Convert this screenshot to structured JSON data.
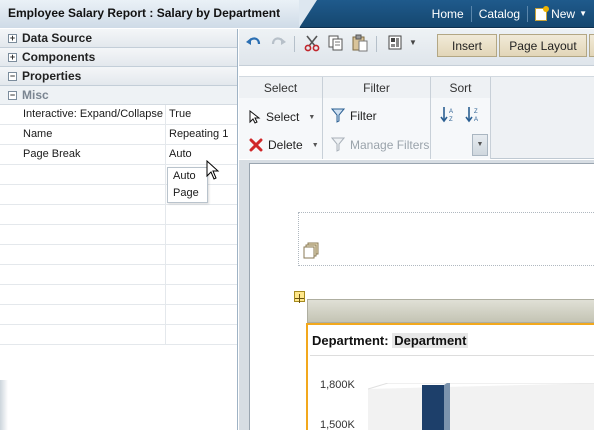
{
  "header": {
    "title": "Employee Salary Report : Salary by Department",
    "nav": {
      "home": "Home",
      "catalog": "Catalog",
      "new": "New"
    }
  },
  "left_panel": {
    "sections": [
      {
        "label": "Data Source",
        "state": "collapsed"
      },
      {
        "label": "Components",
        "state": "collapsed"
      },
      {
        "label": "Properties",
        "state": "expanded"
      }
    ],
    "group": "Misc",
    "properties": [
      {
        "name": "Interactive: Expand/Collapse",
        "value": "True"
      },
      {
        "name": "Name",
        "value": "Repeating 1"
      },
      {
        "name": "Page Break",
        "value": "Auto"
      }
    ],
    "dropdown_options": [
      "Auto",
      "Page"
    ]
  },
  "toolbar": {
    "tabs": [
      "Insert",
      "Page Layout"
    ]
  },
  "ribbon": {
    "select": {
      "title": "Select",
      "select_label": "Select",
      "delete_label": "Delete"
    },
    "filter": {
      "title": "Filter",
      "filter_label": "Filter",
      "manage_label": "Manage Filters"
    },
    "sort": {
      "title": "Sort"
    }
  },
  "canvas": {
    "dept_label": "Department:",
    "dept_field": "Department",
    "y_ticks": [
      "1,800K",
      "1,500K"
    ]
  },
  "colors": {
    "header": "#1f5a8c",
    "accent": "#f2a81d",
    "bar": "#1d3f6a"
  }
}
